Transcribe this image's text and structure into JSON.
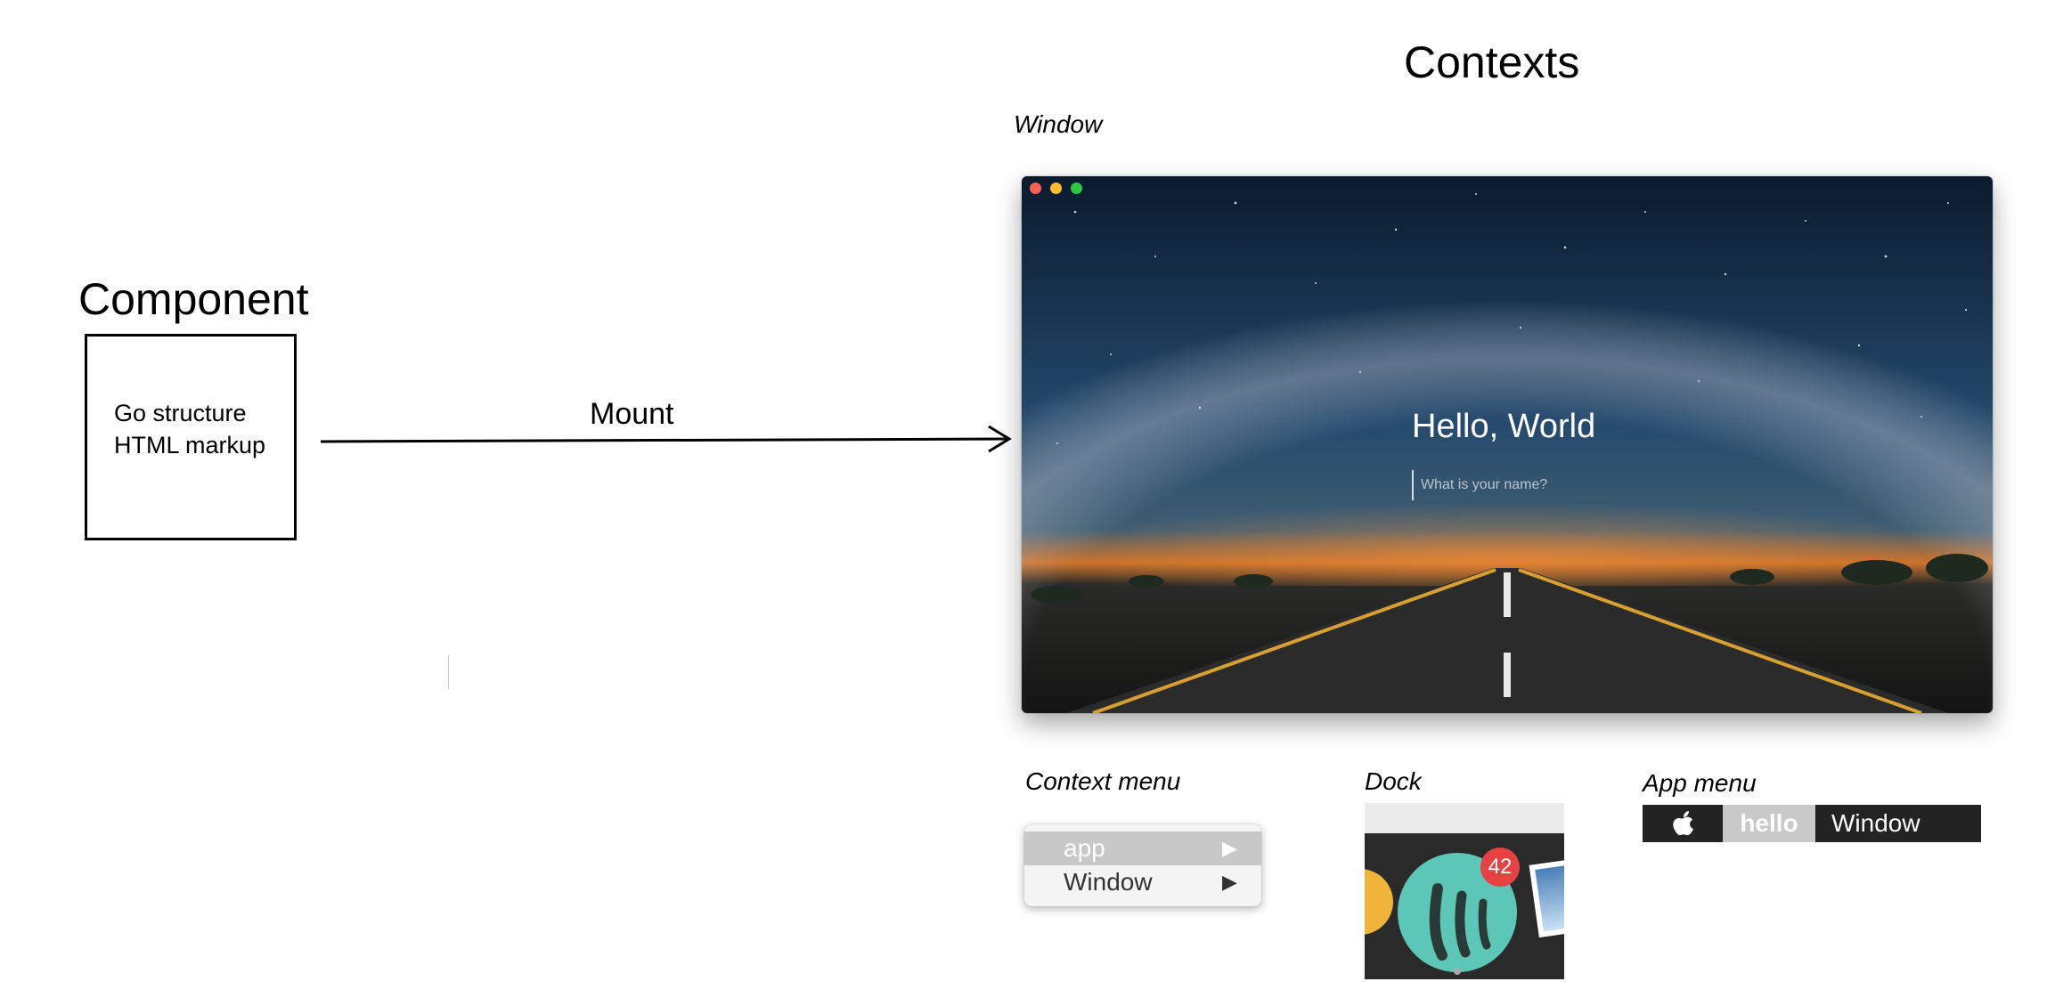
{
  "component": {
    "title": "Component",
    "lines": [
      "Go structure",
      "HTML markup"
    ]
  },
  "mount": {
    "label": "Mount"
  },
  "contexts": {
    "title": "Contexts",
    "window": {
      "caption": "Window",
      "hello": "Hello, World",
      "placeholder": "What is your name?"
    },
    "context_menu": {
      "caption": "Context menu",
      "items": [
        "app",
        "Window"
      ]
    },
    "dock": {
      "caption": "Dock",
      "badge": "42"
    },
    "app_menu": {
      "caption": "App menu",
      "items": [
        "hello",
        "Window"
      ]
    }
  },
  "colors": {
    "traffic_red": "#fc5f57",
    "traffic_yellow": "#fdbc2e",
    "traffic_green": "#29c940",
    "badge_red": "#e84141",
    "dock_app_teal": "#5cc7b7"
  },
  "icons": [
    "apple-icon",
    "submenu-arrow-icon",
    "traffic-light-icon"
  ]
}
